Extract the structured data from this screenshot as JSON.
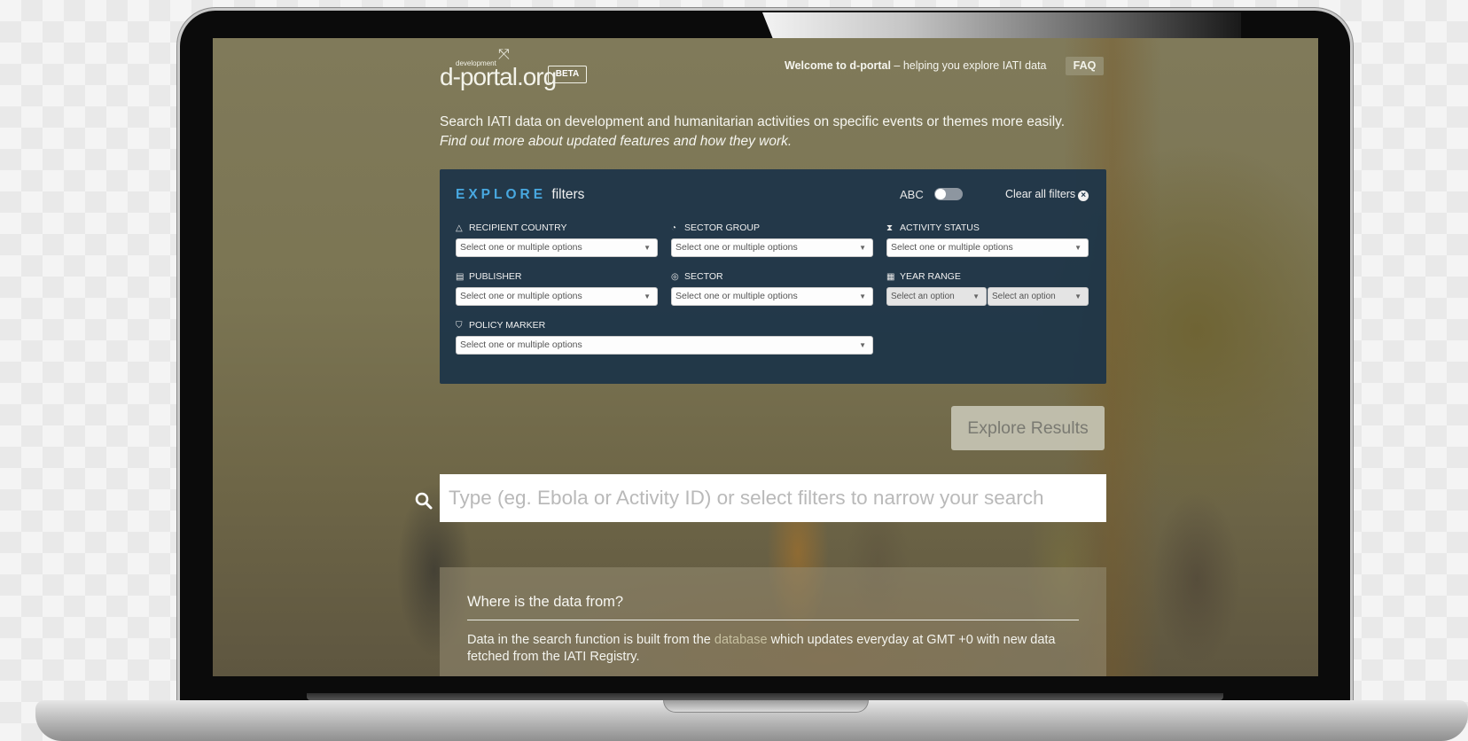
{
  "header": {
    "logo_small": "development",
    "logo_main": "d-portal.org",
    "beta": "BETA",
    "welcome_bold": "Welcome to d-portal",
    "welcome_rest": "– helping you explore IATI data",
    "faq": "FAQ"
  },
  "intro": {
    "line1": "Search IATI data on development and humanitarian activities on specific events or themes more easily.",
    "line2": "Find out more about updated features and how they work."
  },
  "filters": {
    "title_explore": "EXPLORE",
    "title_filters": "filters",
    "abc": "ABC",
    "clear_all": "Clear all filters",
    "items": [
      {
        "label": "RECIPIENT COUNTRY",
        "icon": "triangle-icon",
        "placeholder": "Select one or multiple options"
      },
      {
        "label": "SECTOR GROUP",
        "icon": "pie-icon",
        "placeholder": "Select one or multiple options"
      },
      {
        "label": "ACTIVITY STATUS",
        "icon": "hourglass-icon",
        "placeholder": "Select one or multiple options"
      },
      {
        "label": "PUBLISHER",
        "icon": "document-icon",
        "placeholder": "Select one or multiple options"
      },
      {
        "label": "SECTOR",
        "icon": "target-icon",
        "placeholder": "Select one or multiple options"
      },
      {
        "label": "YEAR RANGE",
        "icon": "calendar-icon",
        "placeholder_from": "Select an option",
        "placeholder_to": "Select an option"
      },
      {
        "label": "POLICY MARKER",
        "icon": "shield-icon",
        "placeholder": "Select one or multiple options"
      }
    ]
  },
  "explore_button": "Explore Results",
  "search": {
    "placeholder": "Type (eg. Ebola or Activity ID) or select filters to narrow your search"
  },
  "info": {
    "title": "Where is the data from?",
    "text_before": "Data in the search function is built from the",
    "link": "database",
    "text_after": "which updates everyday at GMT +0 with new data fetched from the IATI Registry."
  }
}
